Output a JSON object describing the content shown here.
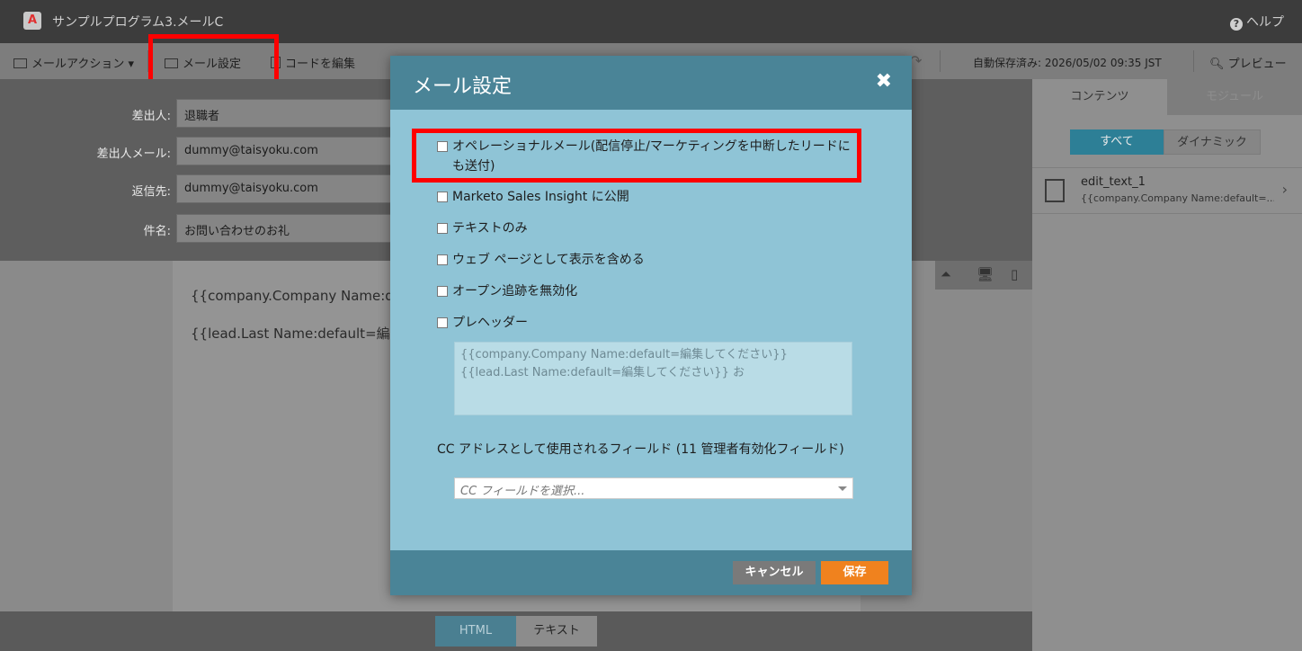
{
  "titlebar": {
    "logo_glyph": "A",
    "title": "サンプルプログラム3.メールC",
    "help_label": "ヘルプ"
  },
  "toolbar": {
    "email_actions": "メールアクション ▾",
    "email_settings": "メール設定",
    "edit_code": "コードを編集",
    "autosave": "自動保存済み: 2026/05/02 09:35 JST",
    "preview": "プレビュー"
  },
  "header_fields": [
    {
      "label": "差出人:",
      "value": "退職者"
    },
    {
      "label": "差出人メール:",
      "value": "dummy@taisyoku.com"
    },
    {
      "label": "返信先:",
      "value": "dummy@taisyoku.com"
    },
    {
      "label": "件名:",
      "value": "お問い合わせのお礼"
    }
  ],
  "canvas": {
    "line1": "{{company.Company Name:de",
    "line2": "{{lead.Last Name:default=編集"
  },
  "bottom_tabs": {
    "html": "HTML",
    "text": "テキスト"
  },
  "right_panel": {
    "tab_content": "コンテンツ",
    "tab_modules": "モジュール",
    "seg_all": "すべて",
    "seg_dynamic": "ダイナミック",
    "item_title": "edit_text_1",
    "item_sub": "{{company.Company Name:default=..."
  },
  "modal": {
    "title": "メール設定",
    "close_glyph": "✖",
    "options": [
      "オペレーショナルメール(配信停止/マーケティングを中断したリードにも送付)",
      "Marketo Sales Insight に公開",
      "テキストのみ",
      "ウェブ ページとして表示を含める",
      "オープン追跡を無効化",
      "プレヘッダー"
    ],
    "preheader_text": "{{company.Company Name:default=編集してください}} {{lead.Last Name:default=編集してください}}  お",
    "cc_label": "CC アドレスとして使用されるフィールド (11 管理者有効化フィールド)",
    "cc_placeholder": "CC フィールドを選択...",
    "cancel": "キャンセル",
    "save": "保存"
  },
  "colors": {
    "modal_header": "#4a8497",
    "modal_body": "#8fc4d6",
    "save_button": "#f0821e",
    "highlight": "#ff0000"
  }
}
